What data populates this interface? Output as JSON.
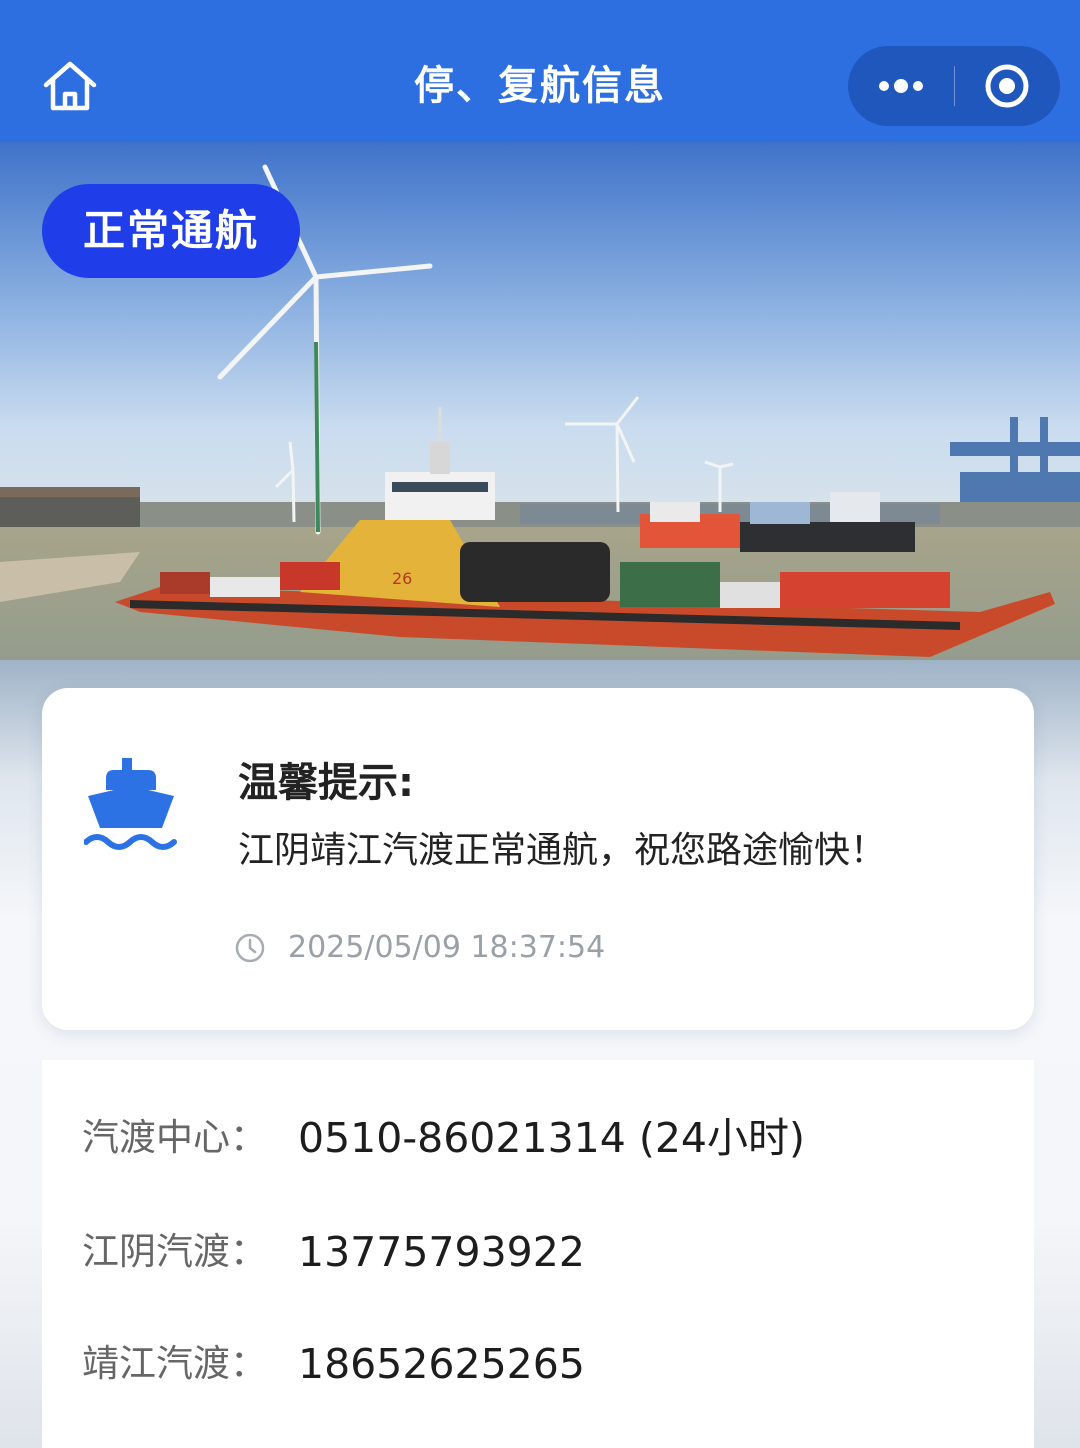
{
  "nav": {
    "title": "停、复航信息",
    "home_icon": "home-icon",
    "more_icon": "more-dots-icon",
    "close_icon": "target-close-icon",
    "color": "#2d6fe0"
  },
  "hero": {
    "status": "正常通航",
    "status_color": "#1f3de8",
    "ferry_number": "26"
  },
  "notice": {
    "icon": "ship-icon",
    "title": "温馨提示:",
    "message": "江阴靖江汽渡正常通航，祝您路途愉快！",
    "time_icon": "clock-icon",
    "time": "2025/05/09 18:37:54"
  },
  "contacts": [
    {
      "label": "汽渡中心：",
      "value": "0510-86021314 (24小时)"
    },
    {
      "label": "江阴汽渡：",
      "value": "13775793922"
    },
    {
      "label": "靖江汽渡：",
      "value": "18652625265"
    }
  ]
}
